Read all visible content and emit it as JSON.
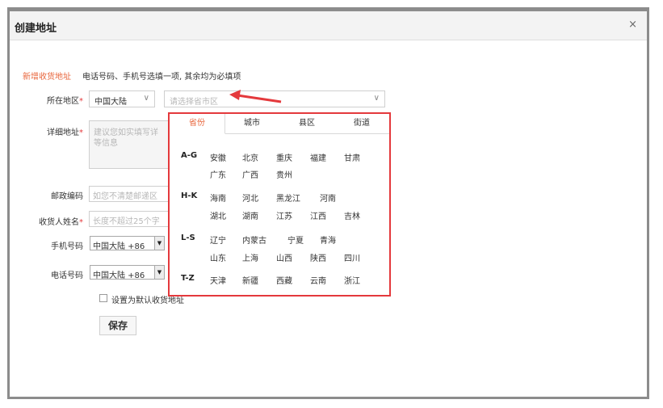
{
  "dialog": {
    "title": "创建地址",
    "close": "×"
  },
  "form": {
    "new_address": "新增收货地址",
    "hint": "电话号码、手机号选填一项, 其余均为必填项",
    "region_label": "所在地区",
    "region_country": "中国大陆",
    "region_placeholder": "请选择省市区",
    "detail_label": "详细地址",
    "detail_placeholder_1": "建议您如实填写详",
    "detail_placeholder_2": "等信息",
    "postcode_label": "邮政编码",
    "postcode_placeholder": "如您不清楚邮递区",
    "name_label": "收货人姓名",
    "name_placeholder": "长度不超过25个字",
    "mobile_label": "手机号码",
    "mobile_code": "中国大陆 +86",
    "phone_label": "电话号码",
    "phone_code": "中国大陆 +86",
    "default_label": "设置为默认收货地址",
    "save": "保存",
    "required_mark": "*"
  },
  "popup": {
    "tabs": [
      "省份",
      "城市",
      "县区",
      "街道"
    ],
    "groups": [
      {
        "label": "A-G",
        "rows": [
          [
            "安徽",
            "北京",
            "重庆",
            "福建",
            "甘肃"
          ],
          [
            "广东",
            "广西",
            "贵州"
          ]
        ]
      },
      {
        "label": "H-K",
        "rows": [
          [
            "海南",
            "河北",
            "黑龙江",
            "河南"
          ],
          [
            "湖北",
            "湖南",
            "江苏",
            "江西",
            "吉林"
          ]
        ]
      },
      {
        "label": "L-S",
        "rows": [
          [
            "辽宁",
            "内蒙古",
            "宁夏",
            "青海"
          ],
          [
            "山东",
            "上海",
            "山西",
            "陕西",
            "四川"
          ]
        ]
      },
      {
        "label": "T-Z",
        "rows": [
          [
            "天津",
            "新疆",
            "西藏",
            "云南",
            "浙江"
          ]
        ]
      }
    ]
  },
  "colors": {
    "accent": "#e8663c",
    "highlight_border": "#e4393c",
    "arrow": "#e4393c"
  }
}
